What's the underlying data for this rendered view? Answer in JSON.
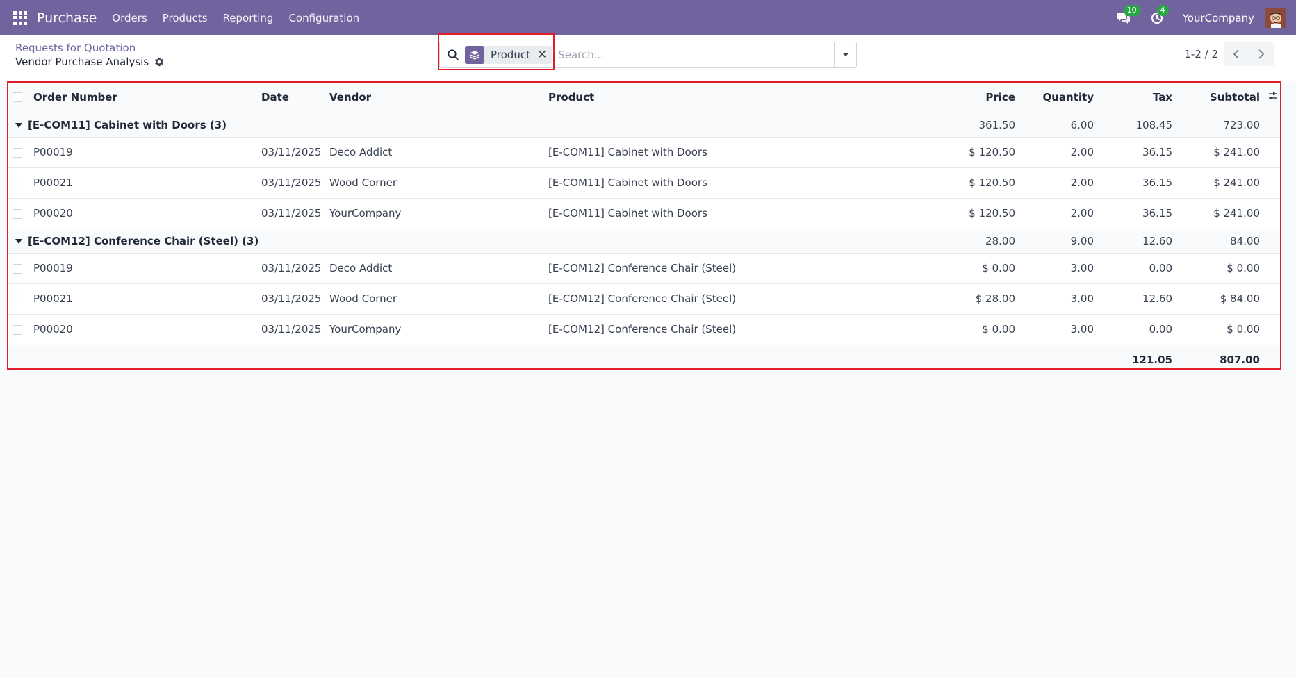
{
  "navbar": {
    "app_name": "Purchase",
    "menu": [
      "Orders",
      "Products",
      "Reporting",
      "Configuration"
    ],
    "messages_badge": "10",
    "activities_badge": "4",
    "company": "YourCompany"
  },
  "control_panel": {
    "breadcrumb": "Requests for Quotation",
    "title": "Vendor Purchase Analysis",
    "search": {
      "facet_label": "Product",
      "placeholder": "Search..."
    },
    "pager": "1-2 / 2"
  },
  "table": {
    "columns": {
      "order_number": "Order Number",
      "date": "Date",
      "vendor": "Vendor",
      "product": "Product",
      "price": "Price",
      "quantity": "Quantity",
      "tax": "Tax",
      "subtotal": "Subtotal"
    },
    "groups": [
      {
        "label": "[E-COM11] Cabinet with Doors (3)",
        "price": "361.50",
        "quantity": "6.00",
        "tax": "108.45",
        "subtotal": "723.00",
        "rows": [
          {
            "order": "P00019",
            "date": "03/11/2025",
            "vendor": "Deco Addict",
            "product": "[E-COM11] Cabinet with Doors",
            "price": "$ 120.50",
            "quantity": "2.00",
            "tax": "36.15",
            "subtotal": "$ 241.00"
          },
          {
            "order": "P00021",
            "date": "03/11/2025",
            "vendor": "Wood Corner",
            "product": "[E-COM11] Cabinet with Doors",
            "price": "$ 120.50",
            "quantity": "2.00",
            "tax": "36.15",
            "subtotal": "$ 241.00"
          },
          {
            "order": "P00020",
            "date": "03/11/2025",
            "vendor": "YourCompany",
            "product": "[E-COM11] Cabinet with Doors",
            "price": "$ 120.50",
            "quantity": "2.00",
            "tax": "36.15",
            "subtotal": "$ 241.00"
          }
        ]
      },
      {
        "label": "[E-COM12] Conference Chair (Steel) (3)",
        "price": "28.00",
        "quantity": "9.00",
        "tax": "12.60",
        "subtotal": "84.00",
        "rows": [
          {
            "order": "P00019",
            "date": "03/11/2025",
            "vendor": "Deco Addict",
            "product": "[E-COM12] Conference Chair (Steel)",
            "price": "$ 0.00",
            "quantity": "3.00",
            "tax": "0.00",
            "subtotal": "$ 0.00"
          },
          {
            "order": "P00021",
            "date": "03/11/2025",
            "vendor": "Wood Corner",
            "product": "[E-COM12] Conference Chair (Steel)",
            "price": "$ 28.00",
            "quantity": "3.00",
            "tax": "12.60",
            "subtotal": "$ 84.00"
          },
          {
            "order": "P00020",
            "date": "03/11/2025",
            "vendor": "YourCompany",
            "product": "[E-COM12] Conference Chair (Steel)",
            "price": "$ 0.00",
            "quantity": "3.00",
            "tax": "0.00",
            "subtotal": "$ 0.00"
          }
        ]
      }
    ],
    "totals": {
      "tax": "121.05",
      "subtotal": "807.00"
    }
  }
}
